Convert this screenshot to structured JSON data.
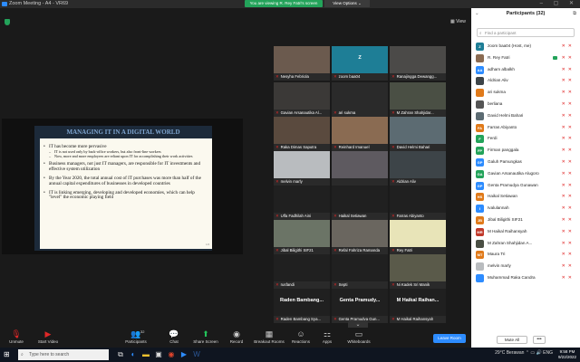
{
  "titlebar": {
    "title": "Zoom Meeting - A4 - VR69",
    "controls": "– ▢ ✕"
  },
  "banner": {
    "viewing": "You are viewing R. Rey Fatri's screen",
    "view_options": "View Options ⌄"
  },
  "meeting": {
    "view_label": "▦ View"
  },
  "slide": {
    "title": "MANAGING IT IN A DIGITAL WORLD",
    "b1": "IT has become more pervasive",
    "b1s1": "IT is not used only by back-office workers, but also front-line workers",
    "b1s2": "Now, more and more employees are reliant upon IT for accomplishing their work activities",
    "b2": "Business managers, not just IT managers, are responsible for IT investments and effective system utilization",
    "b3": "By the Year 2020, the total annual cost of IT purchases was more than half of the annual capital expenditures of businesses in developed countries",
    "b4": "IT is linking emerging, developing and developed economies, which can help \"level\" the economic playing field",
    "page": "1/2"
  },
  "tiles": [
    {
      "name": "Nesyha Febriola",
      "color": "#6b5a4e"
    },
    {
      "name": "zoom baa04",
      "color": "#1e7e96",
      "big": "Z"
    },
    {
      "name": "Ranajingga Dewangg...",
      "color": "#4b4a48"
    },
    {
      "name": "Gavian Arsanautika Al...",
      "color": "#3b3937"
    },
    {
      "name": "ari sukma",
      "color": "#2a2a2a"
    },
    {
      "name": "M Zahran Shahjidar...",
      "color": "#4a4f44"
    },
    {
      "name": "Raka Dimas Saputra",
      "color": "#5a4a3e"
    },
    {
      "name": "Reinhard Imanuel",
      "color": "#8a6b52"
    },
    {
      "name": "David Helmi Bahari",
      "color": "#5c6b72"
    },
    {
      "name": "melvin marly",
      "color": "#b9bcbf"
    },
    {
      "name": "",
      "color": "#5e5a60"
    },
    {
      "name": "Aldrian Aliv",
      "color": "#3d4448"
    },
    {
      "name": "Ulfa Fadhilah Aini",
      "color": "#202020"
    },
    {
      "name": "Haikal Setiawan",
      "color": "#202020"
    },
    {
      "name": "Farras Abiyanto",
      "color": "#202020"
    },
    {
      "name": "Jibal Biligithi SIF21",
      "color": "#6b7466"
    },
    {
      "name": "Refal Fahriza Ramanda",
      "color": "#6a665f"
    },
    {
      "name": "Rey Fatri",
      "color": "#e8e4b8"
    },
    {
      "name": "rusfandi",
      "color": "#202020"
    },
    {
      "name": "Septi",
      "color": "#202020"
    },
    {
      "name": "Ni Kadek Sri Manik",
      "color": "#5a5a4a"
    },
    {
      "name": "Raden Bambang Sya...",
      "color": "#202020",
      "big": "Raden Bambang..."
    },
    {
      "name": "Genta Pramudya Gun...",
      "color": "#202020",
      "big": "Genta Pramudy..."
    },
    {
      "name": "M Haikal Raihansyah",
      "color": "#202020",
      "big": "M Haikal Raihan..."
    }
  ],
  "toolbar": {
    "unmute": "Unmute",
    "start_video": "Start Video",
    "participants": "Participants",
    "participants_count": "32",
    "chat": "Chat",
    "share_screen": "Share Screen",
    "record": "Record",
    "breakout": "Breakout Rooms",
    "reactions": "Reactions",
    "apps": "Apps",
    "whiteboards": "Whiteboards",
    "leave": "Leave Room"
  },
  "panel": {
    "title": "Participants (32)",
    "find_placeholder": "Find a participant",
    "mute_all": "Mute All",
    "more": "•••",
    "people": [
      {
        "initial": "Z",
        "name": "zoom baa04 (Host, me)",
        "color": "#1e7e96"
      },
      {
        "initial": "",
        "name": "R. Rey Fatri",
        "color": "#8a6b52",
        "video": true
      },
      {
        "initial": "AA",
        "name": "adham albalkh",
        "color": "#2d8cff"
      },
      {
        "initial": "",
        "name": "Aldrian Aliv",
        "color": "#3d4448"
      },
      {
        "initial": "",
        "name": "ari sukma",
        "color": "#e07a1a"
      },
      {
        "initial": "",
        "name": "berliana",
        "color": "#555555"
      },
      {
        "initial": "",
        "name": "David Helmi Bahari",
        "color": "#5c6b72"
      },
      {
        "initial": "FA",
        "name": "Farras Abiyanto",
        "color": "#e07a1a"
      },
      {
        "initial": "F",
        "name": "Ferdi",
        "color": "#23a35a"
      },
      {
        "initial": "FP",
        "name": "Firman panggala",
        "color": "#23a35a"
      },
      {
        "initial": "GP",
        "name": "Galuh Pamungkas",
        "color": "#2d8cff"
      },
      {
        "initial": "GA",
        "name": "Gavian Arsanautika Alugoro",
        "color": "#23a35a"
      },
      {
        "initial": "GP",
        "name": "Genta Pramudya Gunawan",
        "color": "#2d8cff"
      },
      {
        "initial": "HS",
        "name": "Haikal Setiawan",
        "color": "#e07a1a"
      },
      {
        "initial": "I",
        "name": "Ivalulannah",
        "color": "#2d8cff"
      },
      {
        "initial": "JB",
        "name": "Jibal Biligithi SIF21",
        "color": "#e07a1a"
      },
      {
        "initial": "MR",
        "name": "M Haikal Raihansyah",
        "color": "#c0392b"
      },
      {
        "initial": "",
        "name": "M Zahran Shahjidan A...",
        "color": "#4a4f44"
      },
      {
        "initial": "MT",
        "name": "Maura Tri",
        "color": "#e07a1a"
      },
      {
        "initial": "",
        "name": "melvin marly",
        "color": "#b9bcbf"
      },
      {
        "initial": "",
        "name": "Muhammad Raka Candra",
        "color": "#2d8cff"
      }
    ]
  },
  "taskbar": {
    "search": "Type here to search",
    "weather": "29°C Berawan",
    "lang": "ENG",
    "time": "9:58 PM",
    "date": "9/22/2022"
  }
}
